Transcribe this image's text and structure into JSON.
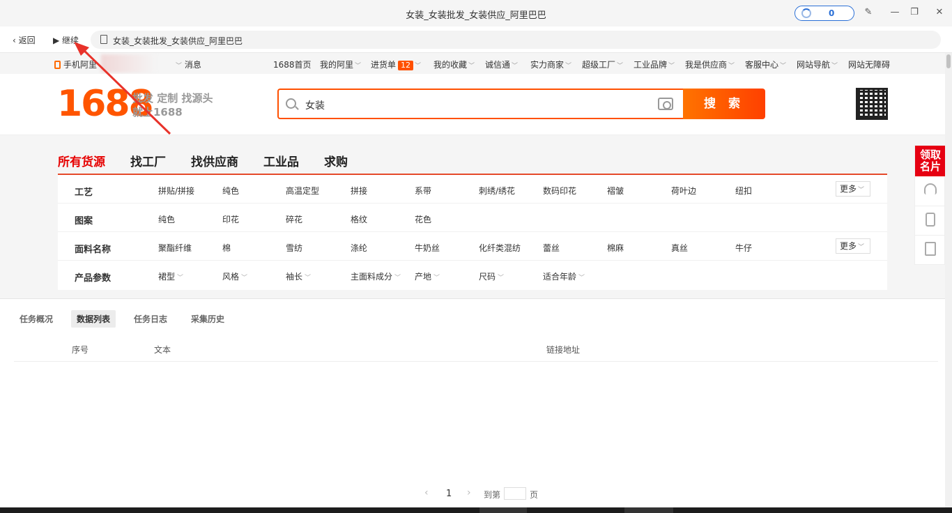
{
  "window": {
    "title": "女装_女装批发_女装供应_阿里巴巴",
    "counter": "0"
  },
  "nav": {
    "back_label": "返回",
    "continue_label": "继续",
    "url": "女装_女装批发_女装供应_阿里巴巴"
  },
  "topbar": {
    "mobile": "手机阿里",
    "message": "消息",
    "items": [
      "1688首页",
      "我的阿里",
      "进货单",
      "我的收藏",
      "诚信通",
      "实力商家",
      "超级工厂",
      "工业品牌",
      "我是供应商",
      "客服中心",
      "网站导航",
      "网站无障碍"
    ],
    "cart_count": "12"
  },
  "header": {
    "logo": "1688",
    "slogan1": "批发 定制 找源头",
    "slogan2": "就上1688",
    "search_value": "女装",
    "search_button": "搜 索"
  },
  "tabs": [
    "所有货源",
    "找工厂",
    "找供应商",
    "工业品",
    "求购"
  ],
  "filters": {
    "more_label": "更多",
    "rows": [
      {
        "label": "工艺",
        "options": [
          "拼贴/拼接",
          "纯色",
          "高温定型",
          "拼接",
          "系带",
          "刺绣/绣花",
          "数码印花",
          "褶皱",
          "荷叶边",
          "纽扣"
        ]
      },
      {
        "label": "图案",
        "options": [
          "纯色",
          "印花",
          "碎花",
          "格纹",
          "花色"
        ]
      },
      {
        "label": "面料名称",
        "options": [
          "聚酯纤维",
          "棉",
          "雪纺",
          "涤纶",
          "牛奶丝",
          "化纤类混纺",
          "蕾丝",
          "棉麻",
          "真丝",
          "牛仔"
        ]
      },
      {
        "label": "产品参数",
        "options": [
          "裙型",
          "风格",
          "袖长",
          "主面料成分",
          "产地",
          "尺码",
          "适合年龄"
        ]
      }
    ]
  },
  "sidebar": {
    "card": "领取名片"
  },
  "panel": {
    "tabs": [
      "任务概况",
      "数据列表",
      "任务日志",
      "采集历史"
    ],
    "columns": [
      "序号",
      "文本",
      "链接地址"
    ],
    "pager": {
      "page": "1",
      "goto": "到第",
      "unit": "页"
    }
  },
  "colors": {
    "brand": "#ff5000",
    "accent_red": "#e60000"
  }
}
